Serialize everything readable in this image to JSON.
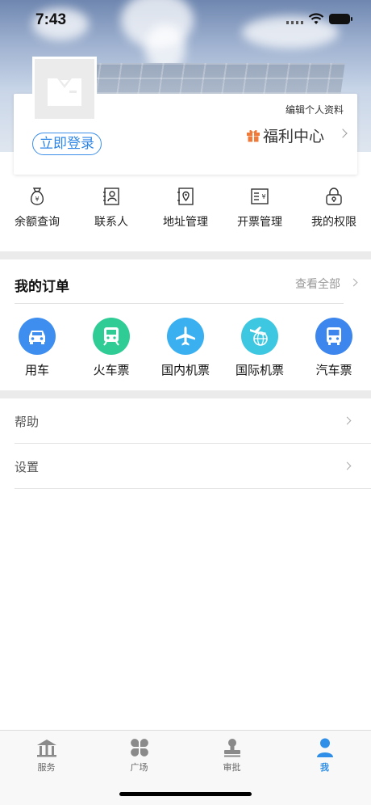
{
  "status_bar": {
    "time": "7:43"
  },
  "profile": {
    "login_label": "立即登录",
    "edit_label": "编辑个人资料",
    "welfare_label": "福利中心"
  },
  "quick_actions": [
    {
      "label": "余额查询",
      "icon": "money-bag-icon"
    },
    {
      "label": "联系人",
      "icon": "contacts-icon"
    },
    {
      "label": "地址管理",
      "icon": "location-doc-icon"
    },
    {
      "label": "开票管理",
      "icon": "invoice-icon"
    },
    {
      "label": "我的权限",
      "icon": "lock-icon"
    }
  ],
  "orders": {
    "title": "我的订单",
    "see_all": "查看全部",
    "items": [
      {
        "label": "用车",
        "icon": "car-icon",
        "color": "#3e8ef0"
      },
      {
        "label": "火车票",
        "icon": "train-icon",
        "color": "#2fcc95"
      },
      {
        "label": "国内机票",
        "icon": "plane-icon",
        "color": "#3ab0f0"
      },
      {
        "label": "国际机票",
        "icon": "globe-plane-icon",
        "color": "#3ec7e0"
      },
      {
        "label": "汽车票",
        "icon": "bus-icon",
        "color": "#3c86ee"
      }
    ]
  },
  "menu": [
    {
      "label": "帮助"
    },
    {
      "label": "设置"
    }
  ],
  "tabbar": [
    {
      "label": "服务",
      "icon": "service-icon"
    },
    {
      "label": "广场",
      "icon": "square-icon"
    },
    {
      "label": "审批",
      "icon": "stamp-icon"
    },
    {
      "label": "我",
      "icon": "person-icon",
      "active": true
    }
  ],
  "colors": {
    "accent": "#2f8fe8",
    "welfare_gift": "#f07a3a"
  }
}
